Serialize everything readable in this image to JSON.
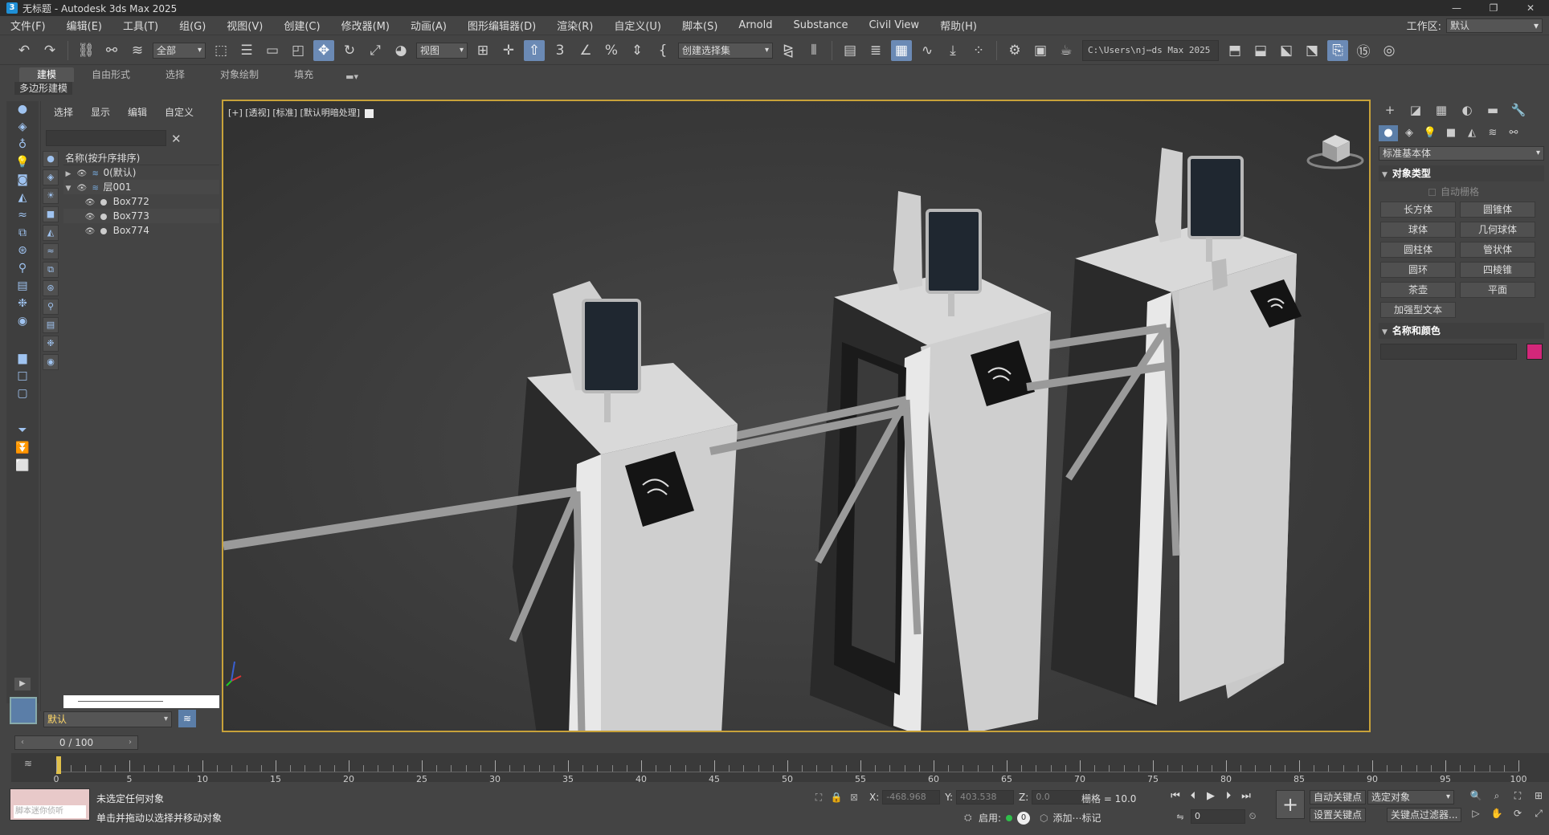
{
  "window": {
    "title": "无标题 - Autodesk 3ds Max 2025",
    "app_icon": "3",
    "minimize": "—",
    "maximize": "❐",
    "close": "✕"
  },
  "menu": {
    "items": [
      "文件(F)",
      "编辑(E)",
      "工具(T)",
      "组(G)",
      "视图(V)",
      "创建(C)",
      "修改器(M)",
      "动画(A)",
      "图形编辑器(D)",
      "渲染(R)",
      "自定义(U)",
      "脚本(S)",
      "Arnold",
      "Substance",
      "Civil View",
      "帮助(H)"
    ],
    "workspace_label": "工作区:",
    "workspace_value": "默认"
  },
  "toolbar": {
    "selection_filter": "全部",
    "ref_coord": "视图",
    "named_selection": "创建选择集",
    "project_path": "C:\\Users\\nj⋯ds Max 2025"
  },
  "ribbon": {
    "tabs": [
      "建模",
      "自由形式",
      "选择",
      "对象绘制",
      "填充"
    ],
    "sub_label": "多边形建模"
  },
  "scene_explorer": {
    "tabs": [
      "选择",
      "显示",
      "编辑",
      "自定义"
    ],
    "column_header": "名称(按升序排序)",
    "rows": [
      {
        "name": "0(默认)",
        "type": "layer"
      },
      {
        "name": "层001",
        "type": "layer"
      },
      {
        "name": "Box772",
        "type": "object"
      },
      {
        "name": "Box773",
        "type": "object"
      },
      {
        "name": "Box774",
        "type": "object"
      }
    ],
    "layer_select": "默认"
  },
  "viewport": {
    "label": "[+] [透视] [标准] [默认明暗处理]"
  },
  "command_panel": {
    "category_dropdown": "标准基本体",
    "section_object_type": "对象类型",
    "auto_grid": "自动栅格",
    "buttons": [
      "长方体",
      "圆锥体",
      "球体",
      "几何球体",
      "圆柱体",
      "管状体",
      "圆环",
      "四棱锥",
      "茶壶",
      "平面",
      "加强型文本"
    ],
    "section_name_color": "名称和颜色",
    "object_color": "#d3277a"
  },
  "timeline": {
    "frame_display": "0 / 100",
    "tick_labels": [
      "0",
      "5",
      "10",
      "15",
      "20",
      "25",
      "30",
      "35",
      "40",
      "45",
      "50",
      "55",
      "60",
      "65",
      "70",
      "75",
      "80",
      "85",
      "90",
      "95",
      "100"
    ]
  },
  "status": {
    "maxscript_placeholder": "脚本迷你侦听",
    "message1": "未选定任何对象",
    "message2": "单击并拖动以选择并移动对象",
    "x_label": "X:",
    "x_value": "-468.968",
    "y_label": "Y:",
    "y_value": "403.538",
    "z_label": "Z:",
    "z_value": "0.0",
    "grid": "栅格 = 10.0",
    "enable_label": "启用:",
    "enable_value": "0",
    "add_time_tag": "添加⋯标记",
    "current_frame": "0",
    "auto_key": "自动关键点",
    "set_key": "设置关键点",
    "key_mode_select": "选定对象",
    "key_filters": "关键点过滤器..."
  }
}
